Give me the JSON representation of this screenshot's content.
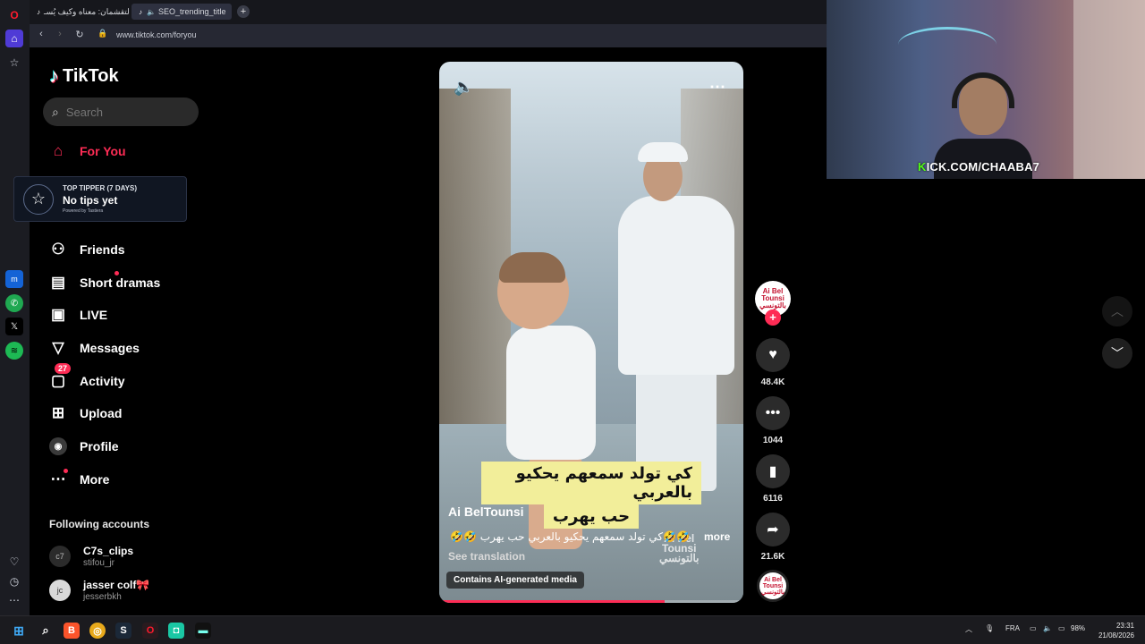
{
  "browser": {
    "tabs": [
      {
        "label": "التقشمان: معناه وكيف يُسـ",
        "icon": "tiktok-icon",
        "active": false
      },
      {
        "label": "SEO_trending_title",
        "icon": "tiktok-icon",
        "active": true
      }
    ],
    "new_tab_label": "+",
    "url": "www.tiktok.com/foryou"
  },
  "tiktok": {
    "brand": "TikTok",
    "search_placeholder": "Search",
    "nav": [
      {
        "label": "For You",
        "icon": "home-icon"
      },
      {
        "label": "Friends",
        "icon": "friends-icon"
      },
      {
        "label": "Short dramas",
        "icon": "film-icon"
      },
      {
        "label": "LIVE",
        "icon": "live-icon"
      },
      {
        "label": "Messages",
        "icon": "send-icon"
      },
      {
        "label": "Activity",
        "icon": "activity-icon",
        "badge": "27"
      },
      {
        "label": "Upload",
        "icon": "plus-square-icon"
      },
      {
        "label": "Profile",
        "icon": "avatar"
      },
      {
        "label": "More",
        "icon": "ellipsis-icon"
      }
    ],
    "tipper": {
      "title": "TOP TIPPER (7 DAYS)",
      "status": "No tips yet",
      "powered": "Powered by Tastiera"
    },
    "following_title": "Following accounts",
    "following": [
      {
        "name": "C7s_clips",
        "handle": "stifou_jr"
      },
      {
        "name": "jasser colf🎀",
        "handle": "jesserbkh"
      }
    ]
  },
  "video": {
    "caption_lines": [
      "كي تولد سمعهم يحكيو بالعربي",
      "حب يهرب"
    ],
    "author": "Ai BelTounsi",
    "description": "🤣🤣كي تولد سمعهم يحكيو بالعربي حب يهرب 🤣🤣 #tunisia",
    "more_label": "more",
    "see_translation": "See translation",
    "ai_label": "Contains AI-generated media",
    "watermark_lines": [
      "Ai Bel",
      "Tounsi",
      "بالتونسي"
    ],
    "progress_percent": 74
  },
  "actions": {
    "avatar_lines": [
      "Ai Bel",
      "Tounsi",
      "بالتونسي"
    ],
    "likes": "48.4K",
    "comments": "1044",
    "saves": "6116",
    "shares": "21.6K"
  },
  "webcam": {
    "overlay_prefix": "K",
    "overlay_text": "ICK.COM/CHAABA7"
  },
  "taskbar": {
    "language": "FRA",
    "battery": "98%",
    "time": "23:31",
    "date": "21/08/2026"
  },
  "colors": {
    "accent": "#fe2c55",
    "kick_green": "#53fc18",
    "caption_bg": "#f2ee9a"
  }
}
